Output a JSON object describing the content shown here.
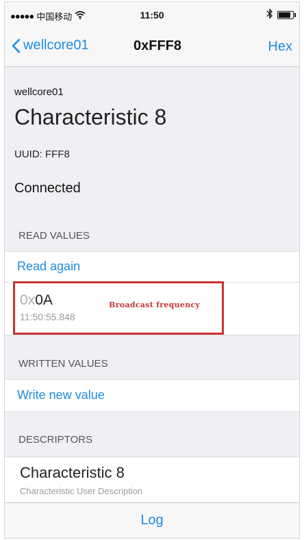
{
  "status_bar": {
    "carrier": "中国移动",
    "time": "11:50",
    "battery_level": 0.85
  },
  "nav": {
    "back_label": "wellcore01",
    "title": "0xFFF8",
    "right_button": "Hex"
  },
  "header": {
    "device_name": "wellcore01",
    "characteristic_title": "Characteristic 8",
    "uuid": "UUID: FFF8",
    "connection_status": "Connected"
  },
  "read_values": {
    "section_title": "READ VALUES",
    "action_label": "Read again",
    "value_prefix": "0x",
    "value": "0A",
    "timestamp": "11:50:55.848",
    "annotation": "Broadcast frequency"
  },
  "written_values": {
    "section_title": "WRITTEN VALUES",
    "action_label": "Write new value"
  },
  "descriptors": {
    "section_title": "DESCRIPTORS",
    "items": [
      {
        "title": "Characteristic 8",
        "subtitle": "Characteristic User Description"
      }
    ]
  },
  "footer": {
    "log_label": "Log"
  },
  "colors": {
    "accent": "#1d8ce0",
    "annotation": "#c83232",
    "background": "#f0f0f4"
  },
  "icons": [
    "signal-dots-icon",
    "wifi-icon",
    "bluetooth-icon",
    "battery-icon",
    "chevron-left-icon"
  ]
}
